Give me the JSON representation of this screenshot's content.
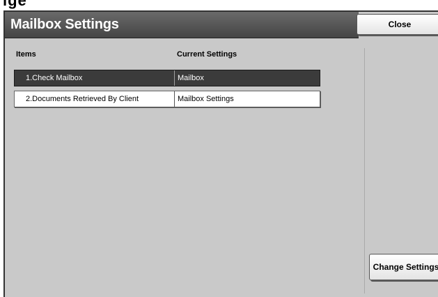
{
  "top_remnant": "ige",
  "title": "Mailbox Settings",
  "buttons": {
    "close": "Close",
    "change_settings": "Change Settings"
  },
  "table": {
    "headers": {
      "items": "Items",
      "current_settings": "Current Settings"
    },
    "rows": [
      {
        "item": "1.Check Mailbox",
        "value": "Mailbox",
        "selected": true
      },
      {
        "item": "2.Documents Retrieved By Client",
        "value": "Mailbox Settings",
        "selected": false
      }
    ]
  },
  "colors": {
    "title_bar": "#454545",
    "panel_background": "#c9c9c9",
    "selected_row": "#3b3b3b"
  }
}
